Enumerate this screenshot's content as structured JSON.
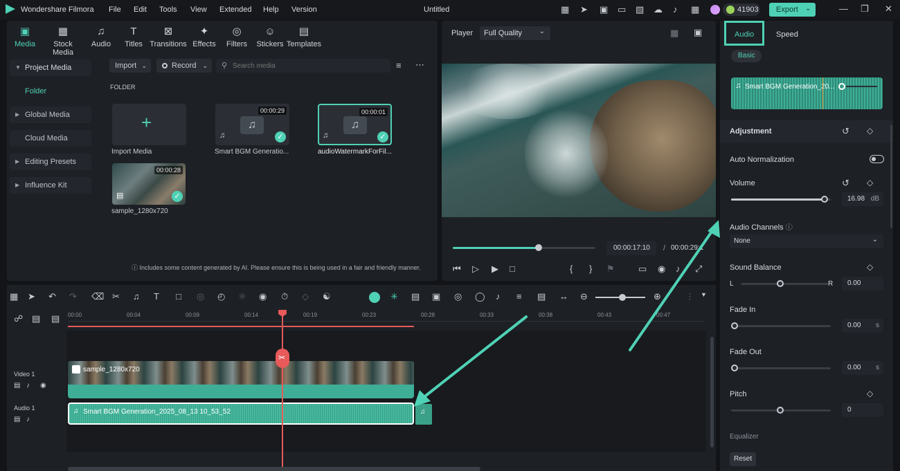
{
  "app": {
    "title": "Wondershare Filmora",
    "project": "Untitled",
    "coins": "41903",
    "export_label": "Export",
    "menu": [
      "File",
      "Edit",
      "Tools",
      "View",
      "Extended",
      "Help",
      "Version"
    ]
  },
  "media": {
    "tabs": [
      {
        "label": "Media",
        "icon": "media-icon"
      },
      {
        "label": "Stock Media",
        "icon": "stock-media-icon"
      },
      {
        "label": "Audio",
        "icon": "audio-icon"
      },
      {
        "label": "Titles",
        "icon": "titles-icon"
      },
      {
        "label": "Transitions",
        "icon": "transitions-icon"
      },
      {
        "label": "Effects",
        "icon": "effects-icon"
      },
      {
        "label": "Filters",
        "icon": "filters-icon"
      },
      {
        "label": "Stickers",
        "icon": "stickers-icon"
      },
      {
        "label": "Templates",
        "icon": "templates-icon"
      }
    ],
    "sidebar": [
      "Project Media",
      "Folder",
      "Global Media",
      "Cloud Media",
      "Editing Presets",
      "Influence Kit"
    ],
    "import_label": "Import",
    "record_label": "Record",
    "search_placeholder": "Search media",
    "folder_heading": "FOLDER",
    "items": [
      {
        "name": "Import Media"
      },
      {
        "name": "Smart BGM Generatio...",
        "duration": "00:00:29"
      },
      {
        "name": "audioWatermarkForFil...",
        "duration": "00:00:01"
      },
      {
        "name": "sample_1280x720",
        "duration": "00:00:28"
      }
    ],
    "notice": "Includes some content generated by AI. Please ensure this is being used in a fair and friendly manner."
  },
  "player": {
    "label": "Player",
    "quality": "Full Quality",
    "current_time": "00:00:17:10",
    "total_time": "00:00:29:1",
    "progress": 0.6
  },
  "right": {
    "tabs": [
      "Audio",
      "Speed"
    ],
    "basic": "Basic",
    "clip_name": "Smart BGM Generation_20...",
    "adjustment": "Adjustment",
    "auto_norm": "Auto Normalization",
    "volume_label": "Volume",
    "volume": "16.98",
    "volume_unit": "dB",
    "channels_label": "Audio Channels",
    "channels_value": "None",
    "balance_label": "Sound Balance",
    "balance_l": "L",
    "balance_r": "R",
    "balance": "0.00",
    "fadein_label": "Fade In",
    "fadein": "0.00",
    "fadeout_label": "Fade Out",
    "fadeout": "0.00",
    "sec": "s",
    "pitch_label": "Pitch",
    "pitch": "0",
    "equalizer_label": "Equalizer",
    "reset_label": "Reset"
  },
  "timeline": {
    "ticks": [
      "00:00",
      "00:04",
      "00:09",
      "00:14",
      "00:19",
      "00:23",
      "00:28",
      "00:33",
      "00:38",
      "00:43",
      "00:47"
    ],
    "video_track": "Video 1",
    "audio_track": "Audio 1",
    "video_clip": "sample_1280x720",
    "audio_clip": "Smart BGM Generation_2025_08_13 10_53_52"
  },
  "colors": {
    "accent": "#4fd1b5",
    "playhead": "#e85a5a"
  }
}
